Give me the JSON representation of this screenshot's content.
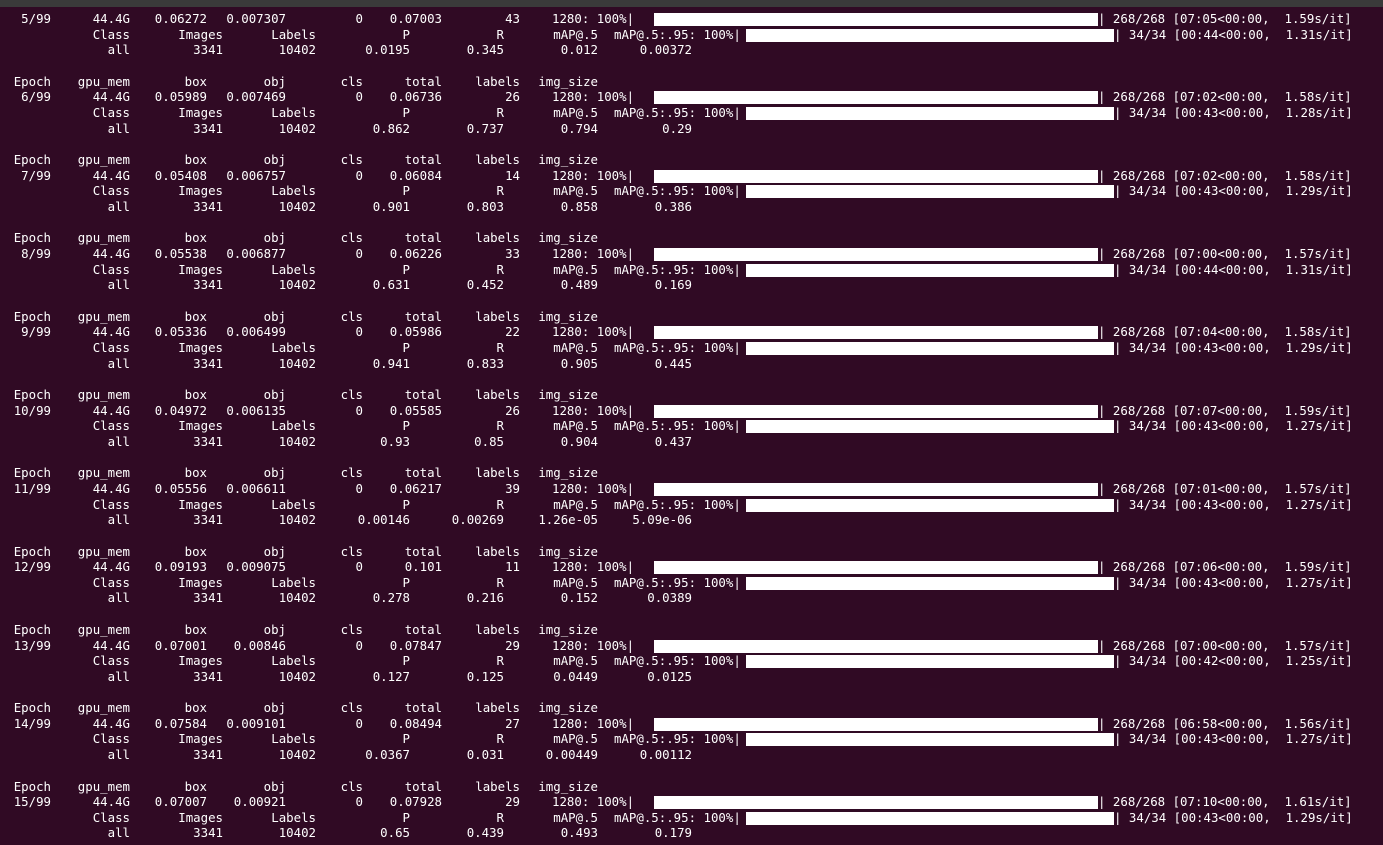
{
  "theme": {
    "background": "#300a24",
    "foreground": "#ffffff",
    "title_strip": "#3a3a3a"
  },
  "header_labels": {
    "epoch": "Epoch",
    "gpu_mem": "gpu_mem",
    "box": "box",
    "obj": "obj",
    "cls": "cls",
    "total": "total",
    "labels": "labels",
    "img_size": "img_size"
  },
  "val_labels": {
    "class": "Class",
    "images": "Images",
    "labels": "Labels",
    "p": "P",
    "r": "R",
    "map50": "mAP@.5",
    "map_prefix": "mAP@.5:.95: 100%|"
  },
  "train_bar_prefix": "1280: 100%|",
  "epochs": [
    {
      "epoch": "5/99",
      "gpu_mem": "44.4G",
      "box": "0.06272",
      "obj": "0.007307",
      "cls": "0",
      "total": "0.07003",
      "labels": "43",
      "train_tail": "| 268/268 [07:05<00:00,  1.59s/it]",
      "val_tail": "| 34/34 [00:44<00:00,  1.31s/it]",
      "all": "all",
      "images": "3341",
      "labels_count": "10402",
      "p": "0.0195",
      "r": "0.345",
      "map50": "0.012",
      "map": "0.00372",
      "show_header": false
    },
    {
      "epoch": "6/99",
      "gpu_mem": "44.4G",
      "box": "0.05989",
      "obj": "0.007469",
      "cls": "0",
      "total": "0.06736",
      "labels": "26",
      "train_tail": "| 268/268 [07:02<00:00,  1.58s/it]",
      "val_tail": "| 34/34 [00:43<00:00,  1.28s/it]",
      "all": "all",
      "images": "3341",
      "labels_count": "10402",
      "p": "0.862",
      "r": "0.737",
      "map50": "0.794",
      "map": "0.29",
      "show_header": true
    },
    {
      "epoch": "7/99",
      "gpu_mem": "44.4G",
      "box": "0.05408",
      "obj": "0.006757",
      "cls": "0",
      "total": "0.06084",
      "labels": "14",
      "train_tail": "| 268/268 [07:02<00:00,  1.58s/it]",
      "val_tail": "| 34/34 [00:43<00:00,  1.29s/it]",
      "all": "all",
      "images": "3341",
      "labels_count": "10402",
      "p": "0.901",
      "r": "0.803",
      "map50": "0.858",
      "map": "0.386",
      "show_header": true
    },
    {
      "epoch": "8/99",
      "gpu_mem": "44.4G",
      "box": "0.05538",
      "obj": "0.006877",
      "cls": "0",
      "total": "0.06226",
      "labels": "33",
      "train_tail": "| 268/268 [07:00<00:00,  1.57s/it]",
      "val_tail": "| 34/34 [00:44<00:00,  1.31s/it]",
      "all": "all",
      "images": "3341",
      "labels_count": "10402",
      "p": "0.631",
      "r": "0.452",
      "map50": "0.489",
      "map": "0.169",
      "show_header": true
    },
    {
      "epoch": "9/99",
      "gpu_mem": "44.4G",
      "box": "0.05336",
      "obj": "0.006499",
      "cls": "0",
      "total": "0.05986",
      "labels": "22",
      "train_tail": "| 268/268 [07:04<00:00,  1.58s/it]",
      "val_tail": "| 34/34 [00:43<00:00,  1.29s/it]",
      "all": "all",
      "images": "3341",
      "labels_count": "10402",
      "p": "0.941",
      "r": "0.833",
      "map50": "0.905",
      "map": "0.445",
      "show_header": true
    },
    {
      "epoch": "10/99",
      "gpu_mem": "44.4G",
      "box": "0.04972",
      "obj": "0.006135",
      "cls": "0",
      "total": "0.05585",
      "labels": "26",
      "train_tail": "| 268/268 [07:07<00:00,  1.59s/it]",
      "val_tail": "| 34/34 [00:43<00:00,  1.27s/it]",
      "all": "all",
      "images": "3341",
      "labels_count": "10402",
      "p": "0.93",
      "r": "0.85",
      "map50": "0.904",
      "map": "0.437",
      "show_header": true
    },
    {
      "epoch": "11/99",
      "gpu_mem": "44.4G",
      "box": "0.05556",
      "obj": "0.006611",
      "cls": "0",
      "total": "0.06217",
      "labels": "39",
      "train_tail": "| 268/268 [07:01<00:00,  1.57s/it]",
      "val_tail": "| 34/34 [00:43<00:00,  1.27s/it]",
      "all": "all",
      "images": "3341",
      "labels_count": "10402",
      "p": "0.00146",
      "r": "0.00269",
      "map50": "1.26e-05",
      "map": "5.09e-06",
      "show_header": true
    },
    {
      "epoch": "12/99",
      "gpu_mem": "44.4G",
      "box": "0.09193",
      "obj": "0.009075",
      "cls": "0",
      "total": "0.101",
      "labels": "11",
      "train_tail": "| 268/268 [07:06<00:00,  1.59s/it]",
      "val_tail": "| 34/34 [00:43<00:00,  1.27s/it]",
      "all": "all",
      "images": "3341",
      "labels_count": "10402",
      "p": "0.278",
      "r": "0.216",
      "map50": "0.152",
      "map": "0.0389",
      "show_header": true
    },
    {
      "epoch": "13/99",
      "gpu_mem": "44.4G",
      "box": "0.07001",
      "obj": "0.00846",
      "cls": "0",
      "total": "0.07847",
      "labels": "29",
      "train_tail": "| 268/268 [07:00<00:00,  1.57s/it]",
      "val_tail": "| 34/34 [00:42<00:00,  1.25s/it]",
      "all": "all",
      "images": "3341",
      "labels_count": "10402",
      "p": "0.127",
      "r": "0.125",
      "map50": "0.0449",
      "map": "0.0125",
      "show_header": true
    },
    {
      "epoch": "14/99",
      "gpu_mem": "44.4G",
      "box": "0.07584",
      "obj": "0.009101",
      "cls": "0",
      "total": "0.08494",
      "labels": "27",
      "train_tail": "| 268/268 [06:58<00:00,  1.56s/it]",
      "val_tail": "| 34/34 [00:43<00:00,  1.27s/it]",
      "all": "all",
      "images": "3341",
      "labels_count": "10402",
      "p": "0.0367",
      "r": "0.031",
      "map50": "0.00449",
      "map": "0.00112",
      "show_header": true
    },
    {
      "epoch": "15/99",
      "gpu_mem": "44.4G",
      "box": "0.07007",
      "obj": "0.00921",
      "cls": "0",
      "total": "0.07928",
      "labels": "29",
      "train_tail": "| 268/268 [07:10<00:00,  1.61s/it]",
      "val_tail": "| 34/34 [00:43<00:00,  1.29s/it]",
      "all": "all",
      "images": "3341",
      "labels_count": "10402",
      "p": "0.65",
      "r": "0.439",
      "map50": "0.493",
      "map": "0.179",
      "show_header": true
    }
  ]
}
